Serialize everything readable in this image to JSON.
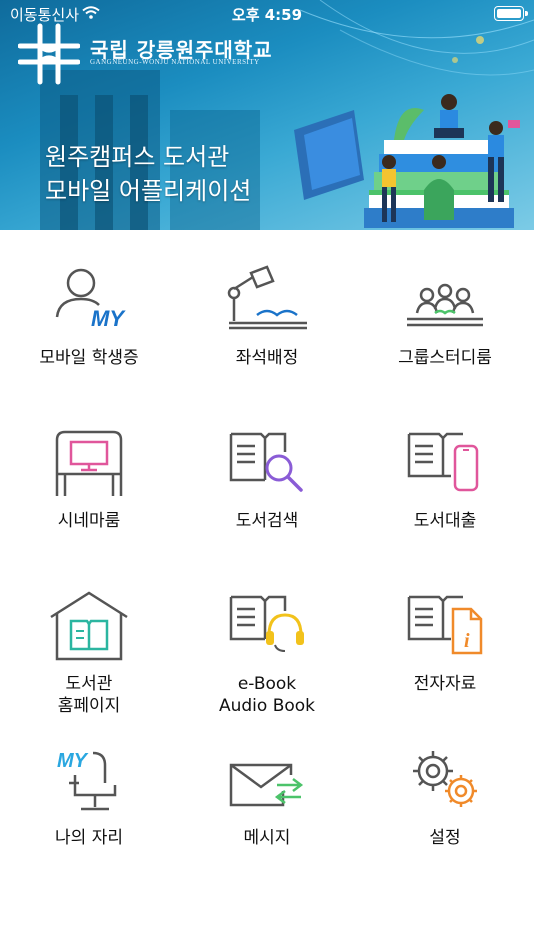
{
  "status_bar": {
    "carrier": "이동통신사",
    "time": "오후 4:59"
  },
  "banner": {
    "university_name": "국립 강릉원주대학교",
    "university_name_en": "GANGNEUNG-WONJU NATIONAL UNIVERSITY",
    "headline_line1": "원주캠퍼스 도서관",
    "headline_line2": "모바일 어플리케이션"
  },
  "menu": [
    {
      "id": "mobile-student-id",
      "label": "모바일 학생증",
      "label2": "",
      "icon": "user-my-icon"
    },
    {
      "id": "seat-assignment",
      "label": "좌석배정",
      "label2": "",
      "icon": "desk-lamp-icon"
    },
    {
      "id": "group-study-room",
      "label": "그룹스터디룸",
      "label2": "",
      "icon": "group-icon"
    },
    {
      "id": "cinema-room",
      "label": "시네마룸",
      "label2": "",
      "icon": "cinema-booth-icon"
    },
    {
      "id": "book-search",
      "label": "도서검색",
      "label2": "",
      "icon": "book-search-icon"
    },
    {
      "id": "book-loan",
      "label": "도서대출",
      "label2": "",
      "icon": "book-phone-icon"
    },
    {
      "id": "library-homepage",
      "label": "도서관",
      "label2": "홈페이지",
      "icon": "library-house-icon"
    },
    {
      "id": "ebook-audiobook",
      "label": "e-Book",
      "label2": "Audio Book",
      "icon": "book-headset-icon"
    },
    {
      "id": "electronic-resources",
      "label": "전자자료",
      "label2": "",
      "icon": "book-info-icon"
    },
    {
      "id": "my-seat",
      "label": "나의 자리",
      "label2": "",
      "icon": "chair-my-icon"
    },
    {
      "id": "message",
      "label": "메시지",
      "label2": "",
      "icon": "envelope-icon"
    },
    {
      "id": "settings",
      "label": "설정",
      "label2": "",
      "icon": "gears-icon"
    }
  ],
  "colors": {
    "accent_blue": "#1a73c9",
    "accent_green": "#4cc36a",
    "accent_pink": "#e0569b",
    "accent_yellow": "#f2c21b",
    "accent_orange": "#f08a2a",
    "accent_purple": "#8a5cd6"
  }
}
